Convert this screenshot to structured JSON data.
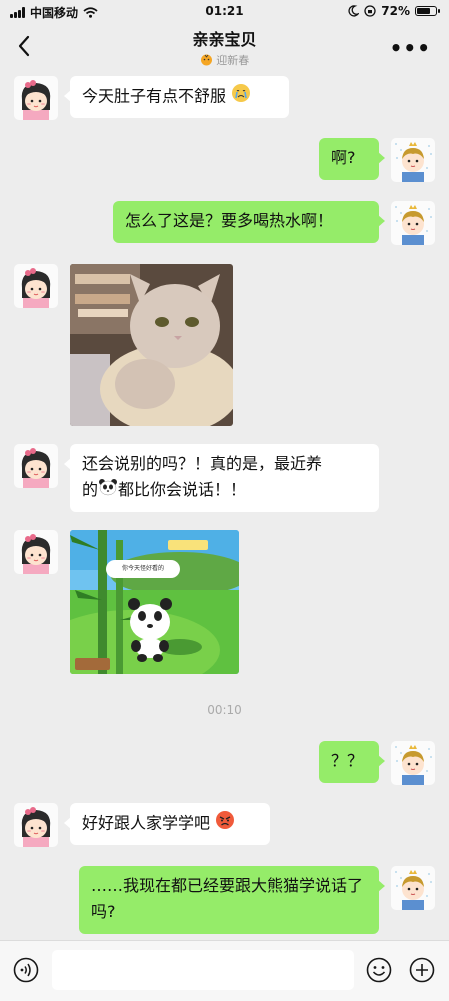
{
  "status_bar": {
    "carrier": "中国移动",
    "time": "01:21",
    "battery": "72%",
    "battery_level": 0.72
  },
  "header": {
    "title": "亲亲宝贝",
    "subtitle": "迎新春",
    "subtitle_icon": "tiger-emoji-icon",
    "more_label": "•••"
  },
  "messages": [
    {
      "side": "in",
      "type": "text",
      "text": "今天肚子有点不舒服",
      "emoji": "crying-face"
    },
    {
      "side": "out",
      "type": "text",
      "text": "啊?"
    },
    {
      "side": "out",
      "type": "text",
      "text": "怎么了这是？要多喝热水啊！"
    },
    {
      "side": "in",
      "type": "image",
      "image": "cat-photo"
    },
    {
      "side": "in",
      "type": "text",
      "text_lines": [
        "还会说别的吗？！真的是，最近养",
        "的",
        "都比你会说话！！"
      ],
      "emoji": "panda-face"
    },
    {
      "side": "in",
      "type": "image",
      "image": "panda-game-screenshot",
      "image_caption": "你今天怪好看的"
    },
    {
      "side": "system",
      "type": "timestamp",
      "text": "00:10"
    },
    {
      "side": "out",
      "type": "text",
      "text": "？？"
    },
    {
      "side": "in",
      "type": "text",
      "text": "好好跟人家学学吧",
      "emoji": "angry-face"
    },
    {
      "side": "out",
      "type": "text",
      "text": "……我现在都已经要跟大熊猫学说话了吗?"
    }
  ],
  "colors": {
    "background": "#ededed",
    "outgoing_bubble": "#95ec69",
    "incoming_bubble": "#ffffff"
  },
  "icons": [
    "signal-icon",
    "wifi-icon",
    "moon-icon",
    "lock-rotation-icon",
    "battery-icon",
    "back-arrow-icon",
    "more-icon",
    "voice-input-icon",
    "emoji-icon",
    "plus-icon"
  ]
}
